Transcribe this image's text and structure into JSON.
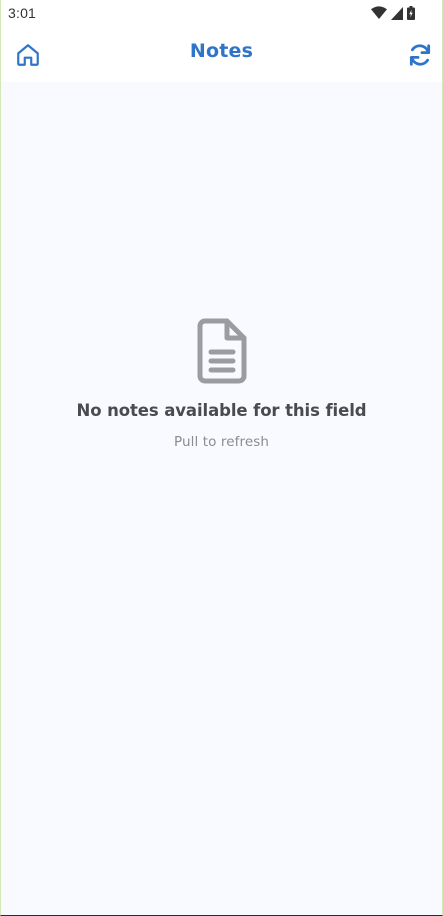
{
  "status_bar": {
    "time": "3:01",
    "icons": [
      "wifi-icon",
      "cell-signal-icon",
      "battery-icon"
    ]
  },
  "app_bar": {
    "title": "Notes",
    "left_icon": "home-icon",
    "right_icon": "refresh-icon"
  },
  "empty_state": {
    "icon": "document-icon",
    "message": "No notes available for this field",
    "hint": "Pull to refresh"
  },
  "colors": {
    "accent": "#2f74c9",
    "background": "#f8faff",
    "icon_gray": "#9b9ca1",
    "message_text": "#4a4b50",
    "hint_text": "#8a8c92"
  }
}
